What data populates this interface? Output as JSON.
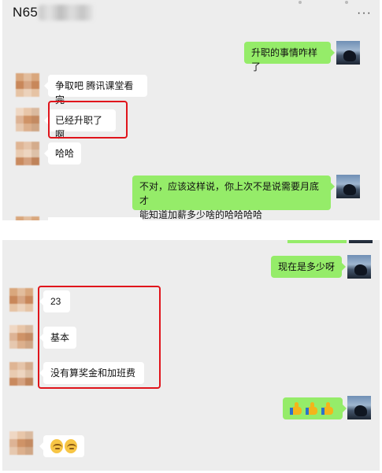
{
  "header": {
    "title": "N65",
    "more_label": "···"
  },
  "conversation_top": [
    {
      "id": "m1",
      "side": "out",
      "text": "升职的事情咋样了"
    },
    {
      "id": "m2",
      "side": "in",
      "text": "争取吧 腾讯课堂看完"
    },
    {
      "id": "m3",
      "side": "in",
      "text": "已经升职了啊",
      "highlighted": true
    },
    {
      "id": "m4",
      "side": "in",
      "text": "哈哈"
    },
    {
      "id": "m5",
      "side": "out",
      "lines": [
        "不对，应该这样说，你上次不是说需要月底才",
        "能知道加薪多少啥的哈哈哈哈"
      ]
    }
  ],
  "conversation_bottom": [
    {
      "id": "m6",
      "side": "out",
      "text": "现在是多少呀"
    },
    {
      "id": "m7",
      "side": "in",
      "text": "23",
      "highlighted": true
    },
    {
      "id": "m8",
      "side": "in",
      "text": "基本",
      "highlighted": true
    },
    {
      "id": "m9",
      "side": "in",
      "text": "没有算奖金和加班费",
      "highlighted": true
    },
    {
      "id": "m10",
      "side": "out",
      "emoji": [
        "thumbs-up",
        "thumbs-up",
        "thumbs-up"
      ]
    },
    {
      "id": "m11",
      "side": "in",
      "emoji": [
        "face-smile",
        "face-smile"
      ]
    }
  ],
  "colors": {
    "chat_background": "#ededed",
    "outgoing_bubble": "#95ec69",
    "incoming_bubble": "#ffffff",
    "highlight_box": "#e0141b"
  }
}
